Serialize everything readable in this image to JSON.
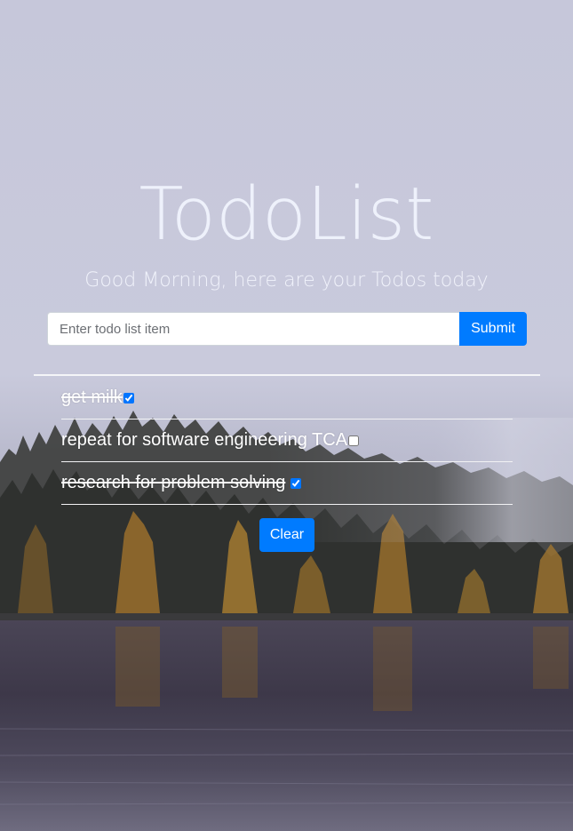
{
  "header": {
    "title": "TodoList",
    "subtitle": "Good Morning, here are your Todos today"
  },
  "form": {
    "input_placeholder": "Enter todo list item",
    "input_value": "",
    "submit_label": "Submit"
  },
  "todos": [
    {
      "text": "get milk",
      "done": true
    },
    {
      "text": "repeat for software engineering TCA",
      "done": false
    },
    {
      "text": "research for problem solving",
      "done": true
    }
  ],
  "actions": {
    "clear_label": "Clear"
  },
  "colors": {
    "accent": "#007bff",
    "title_text": "#eef1fb",
    "sky": "#c8c9dc"
  }
}
